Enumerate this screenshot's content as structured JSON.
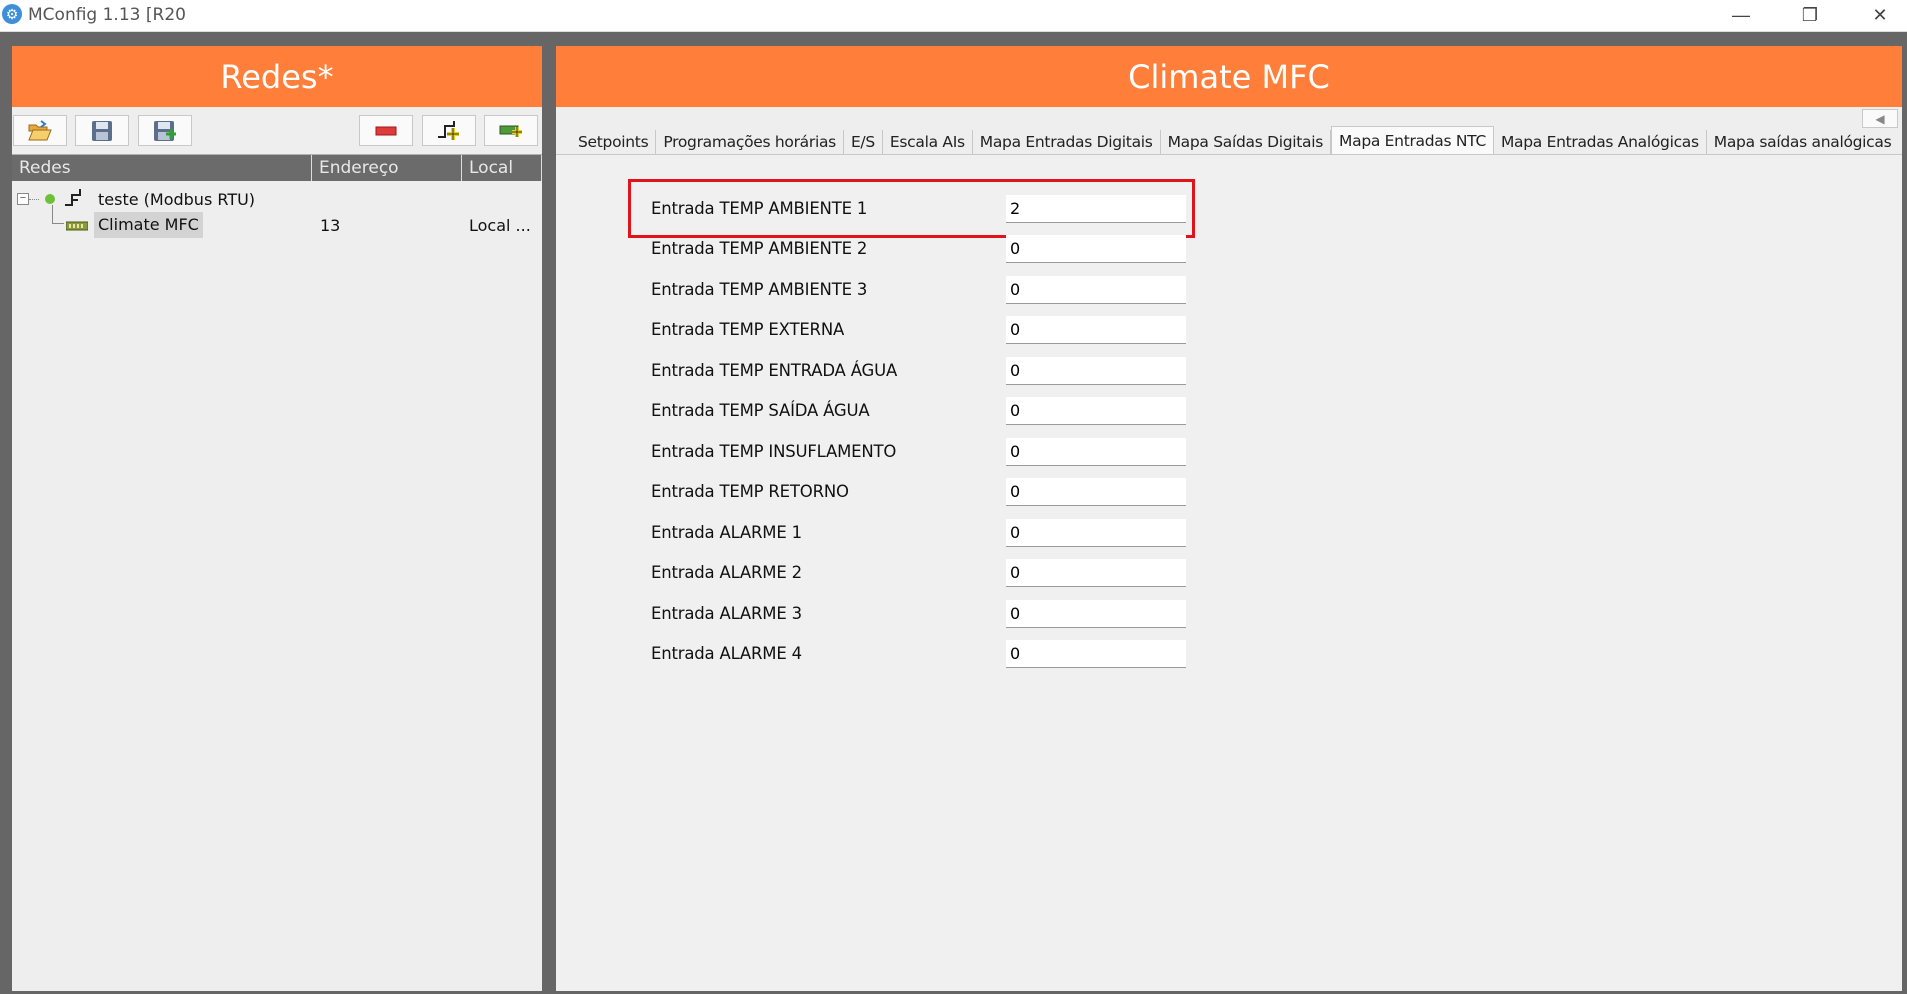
{
  "window": {
    "title": "MConfig 1.13 [R20",
    "minimize_icon": "minimize-icon",
    "restore_icon": "restore-icon",
    "close_icon": "close-icon"
  },
  "left": {
    "header": "Redes*",
    "toolbar": [
      {
        "name": "open-button",
        "icon": "folder-open-icon"
      },
      {
        "name": "save-button",
        "icon": "floppy-disk-icon"
      },
      {
        "name": "save-as-button",
        "icon": "floppy-disk-add-icon"
      },
      {
        "name": "remove-button",
        "icon": "minus-icon"
      },
      {
        "name": "add-network-button",
        "icon": "network-add-icon"
      },
      {
        "name": "add-device-button",
        "icon": "device-add-icon"
      }
    ],
    "columns": [
      "Redes",
      "Endereço",
      "Local"
    ],
    "tree": {
      "network": "teste (Modbus RTU)",
      "device": "Climate MFC",
      "address": "13",
      "local": "Local ..."
    }
  },
  "right": {
    "header": "Climate MFC",
    "tabs": [
      "Setpoints",
      "Programações horárias",
      "E/S",
      "Escala AIs",
      "Mapa Entradas Digitais",
      "Mapa Saídas Digitais",
      "Mapa Entradas NTC",
      "Mapa Entradas Analógicas",
      "Mapa saídas analógicas"
    ],
    "active_tab": "Mapa Entradas NTC",
    "fields": [
      {
        "label": "Entrada TEMP AMBIENTE 1",
        "value": "2"
      },
      {
        "label": "Entrada TEMP AMBIENTE 2",
        "value": "0"
      },
      {
        "label": "Entrada TEMP AMBIENTE 3",
        "value": "0"
      },
      {
        "label": "Entrada TEMP EXTERNA",
        "value": "0"
      },
      {
        "label": "Entrada TEMP ENTRADA ÁGUA",
        "value": "0"
      },
      {
        "label": "Entrada TEMP SAÍDA ÁGUA",
        "value": "0"
      },
      {
        "label": "Entrada TEMP INSUFLAMENTO",
        "value": "0"
      },
      {
        "label": "Entrada TEMP RETORNO",
        "value": "0"
      },
      {
        "label": "Entrada ALARME 1",
        "value": "0"
      },
      {
        "label": "Entrada ALARME 2",
        "value": "0"
      },
      {
        "label": "Entrada ALARME 3",
        "value": "0"
      },
      {
        "label": "Entrada ALARME 4",
        "value": "0"
      }
    ]
  },
  "colors": {
    "accent": "#ff7f3a",
    "highlight": "#e0141b"
  }
}
